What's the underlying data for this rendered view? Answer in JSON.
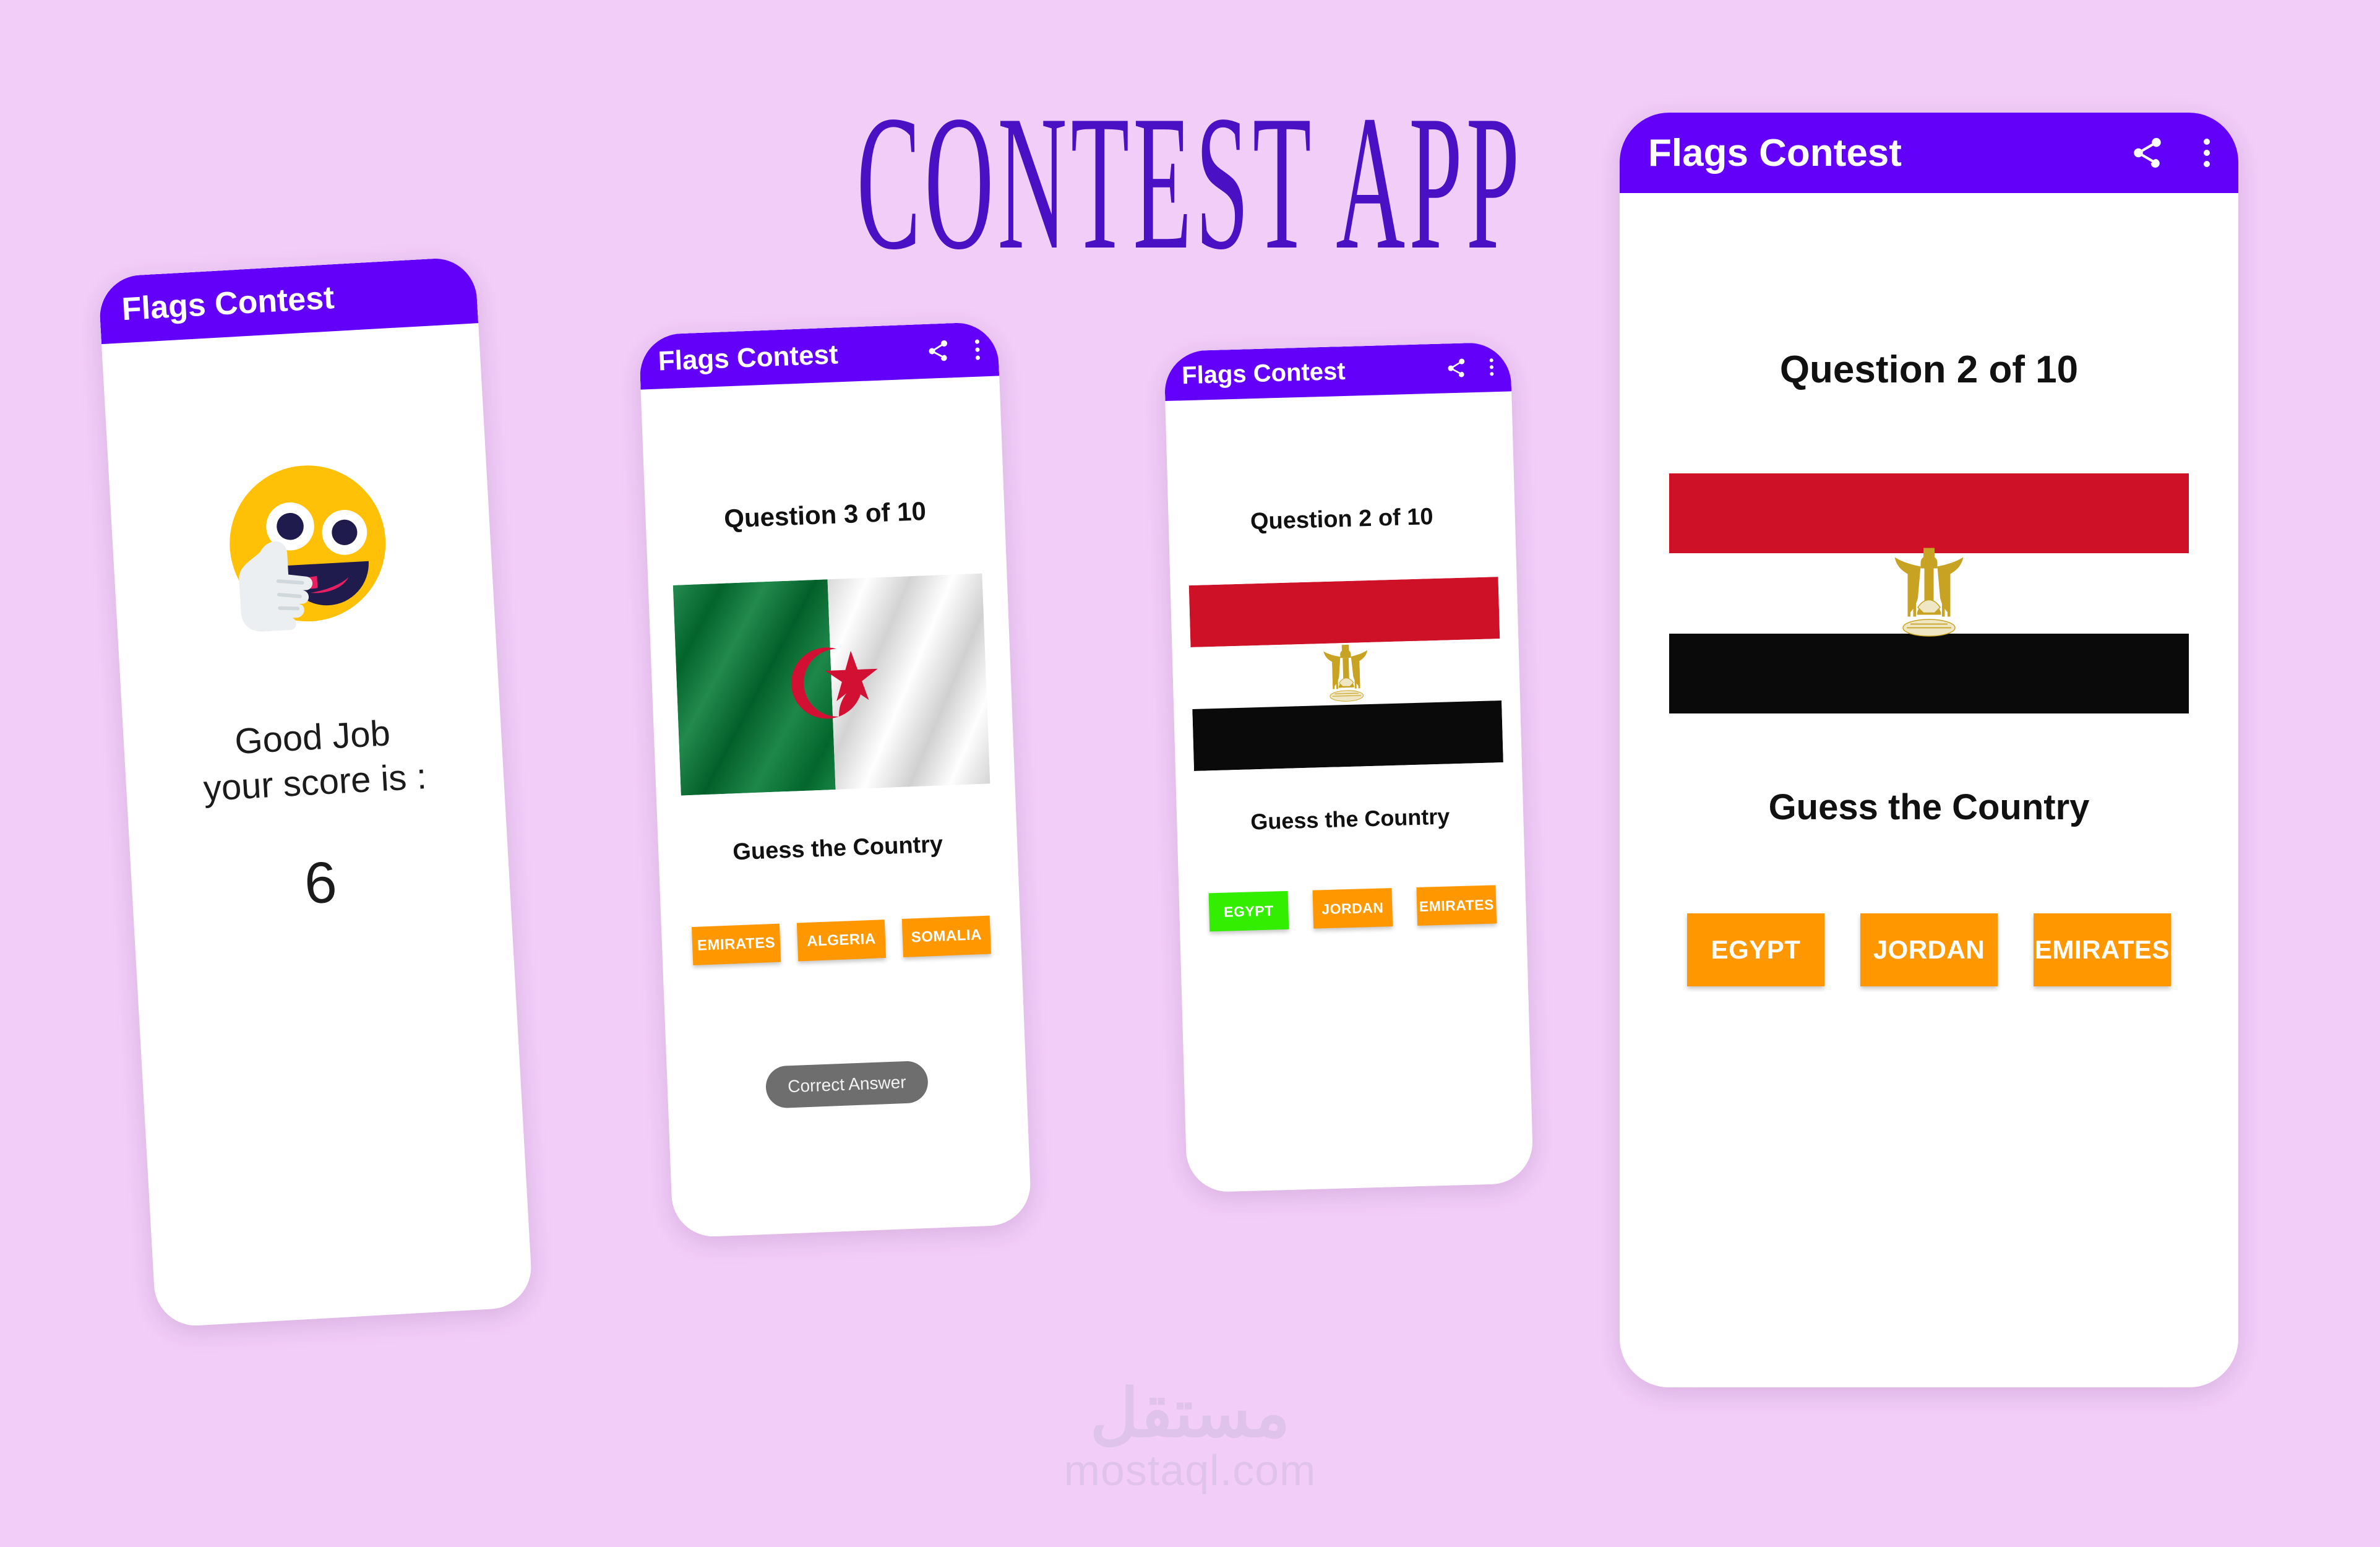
{
  "poster": {
    "title": "CONTEST APP",
    "background_color": "#F2CDF7",
    "title_color": "#4910C4"
  },
  "watermark": {
    "arabic": "مستقل",
    "url": "mostaql.com"
  },
  "theme": {
    "appbar_color": "#6200FA",
    "answer_button_color": "#FF9800",
    "correct_answer_color": "#33EE00",
    "toast_color": "#6E6E6E",
    "flag_red": "#CE1126",
    "flag_black": "#0A0A0A",
    "flag_green": "#047A35",
    "emblem_gold": "#C8A323"
  },
  "appbar": {
    "title": "Flags Contest",
    "share_icon": "share-icon",
    "overflow_icon": "more-vertical-icon"
  },
  "screens": {
    "score": {
      "appbar_title": "Flags Contest",
      "emoji": "smiling-face-with-thumbs-up",
      "message_line1": "Good Job",
      "message_line2": "your score is :",
      "score": "6"
    },
    "question3": {
      "appbar_title": "Flags Contest",
      "question_label": "Question 3 of 10",
      "flag": "algeria-flag",
      "prompt": "Guess the Country",
      "answers": [
        {
          "label": "EMIRATES",
          "state": "default"
        },
        {
          "label": "ALGERIA",
          "state": "default"
        },
        {
          "label": "SOMALIA",
          "state": "default"
        }
      ],
      "toast": "Correct Answer"
    },
    "question2_small": {
      "appbar_title": "Flags Contest",
      "question_label": "Question 2 of 10",
      "flag": "egypt-flag",
      "prompt": "Guess the Country",
      "answers": [
        {
          "label": "EGYPT",
          "state": "correct"
        },
        {
          "label": "JORDAN",
          "state": "default"
        },
        {
          "label": "EMIRATES",
          "state": "default"
        }
      ]
    },
    "question2_hero": {
      "appbar_title": "Flags Contest",
      "question_label": "Question 2 of 10",
      "flag": "egypt-flag",
      "prompt": "Guess the Country",
      "answers": [
        {
          "label": "EGYPT",
          "state": "default"
        },
        {
          "label": "JORDAN",
          "state": "default"
        },
        {
          "label": "EMIRATES",
          "state": "default"
        }
      ]
    }
  }
}
